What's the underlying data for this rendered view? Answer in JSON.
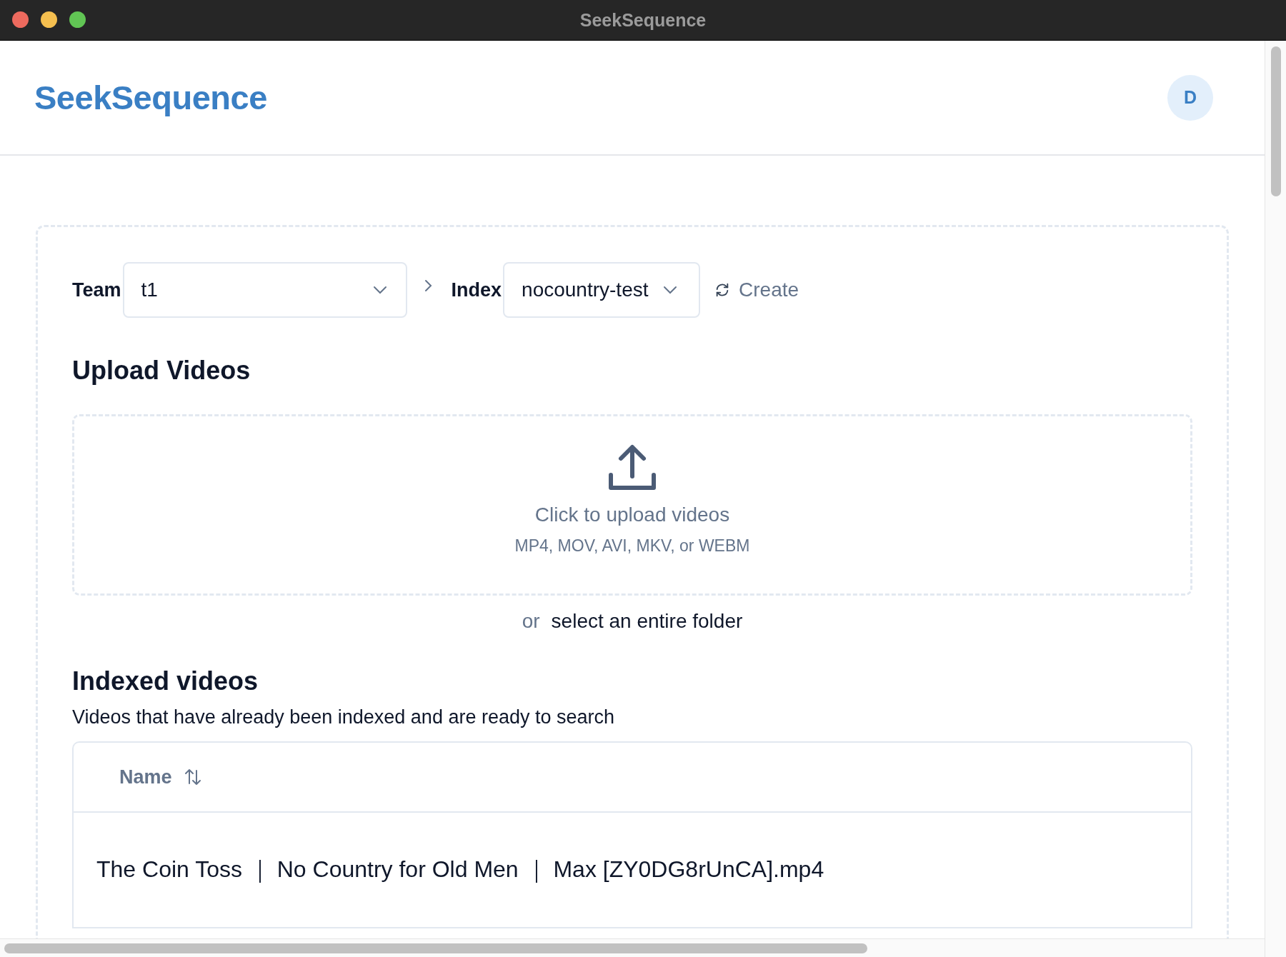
{
  "window": {
    "title": "SeekSequence"
  },
  "header": {
    "logo": "SeekSequence",
    "avatar": "D"
  },
  "selectors": [
    {
      "label": "Team",
      "value": "t1"
    },
    {
      "label": "Index",
      "value": "nocountry-test"
    }
  ],
  "create_button": "Create",
  "upload": {
    "heading": "Upload Videos",
    "prompt": "Click to upload videos",
    "formats": "MP4, MOV, AVI, MKV, or WEBM",
    "or": "or",
    "folder_link": "select an entire folder"
  },
  "indexed": {
    "heading": "Indexed videos",
    "description": "Videos that have already been indexed and are ready to search",
    "table": {
      "columns": [
        {
          "label": "Name",
          "sortable": true
        }
      ],
      "rows": [
        {
          "name": "The Coin Toss ｜ No Country for Old Men ｜ Max [ZY0DG8rUnCA].mp4"
        }
      ]
    }
  }
}
